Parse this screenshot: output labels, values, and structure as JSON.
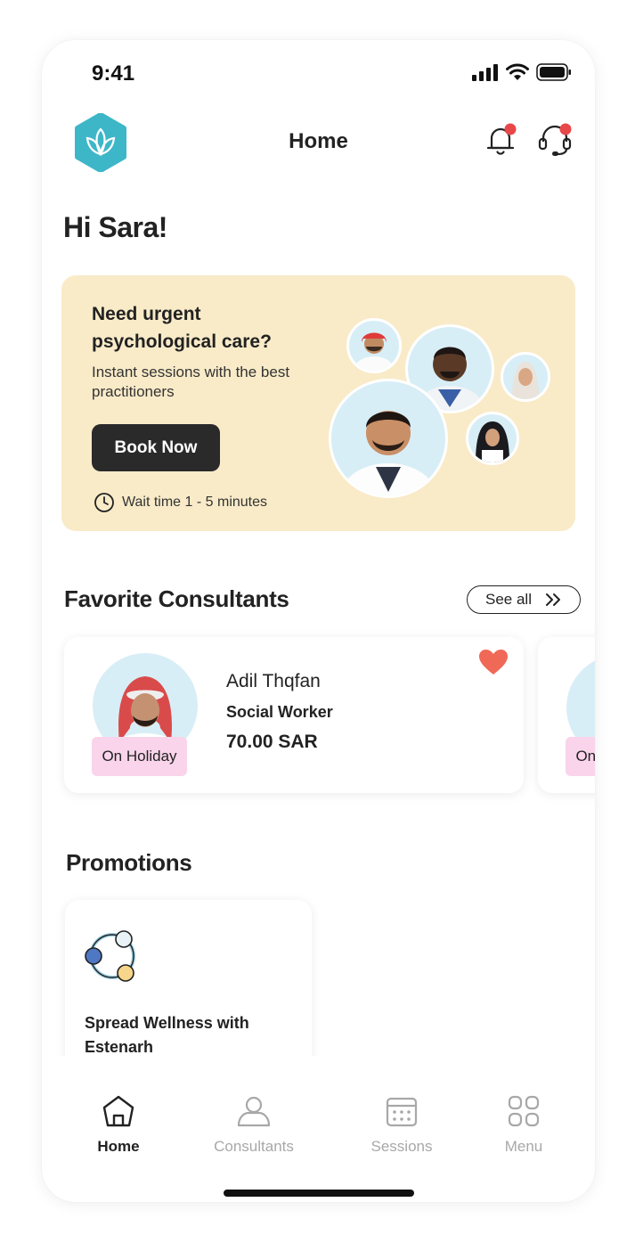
{
  "status_bar": {
    "time": "9:41"
  },
  "header": {
    "title": "Home"
  },
  "greeting": "Hi Sara!",
  "urgent_card": {
    "title": "Need urgent psychological care?",
    "subtitle": "Instant sessions with the best practitioners",
    "button_label": "Book Now",
    "wait_text": "Wait time 1 - 5 minutes"
  },
  "favorites": {
    "title": "Favorite Consultants",
    "see_all_label": "See all",
    "items": [
      {
        "name": "Adil Thqfan",
        "role": "Social Worker",
        "price": "70.00 SAR",
        "status": "On Holiday",
        "favorite": true
      },
      {
        "status": "On Holiday"
      }
    ]
  },
  "promotions": {
    "title": "Promotions",
    "items": [
      {
        "title": "Spread Wellness with Estenarh"
      }
    ]
  },
  "bottom_nav": {
    "items": [
      {
        "label": "Home",
        "icon": "home-icon",
        "active": true
      },
      {
        "label": "Consultants",
        "icon": "person-icon",
        "active": false
      },
      {
        "label": "Sessions",
        "icon": "calendar-icon",
        "active": false
      },
      {
        "label": "Menu",
        "icon": "grid-icon",
        "active": false
      }
    ]
  },
  "colors": {
    "accent": "#3db6c8",
    "card_yellow": "#f9ebc8",
    "badge_pink": "#f9d4ea",
    "heart": "#f06856",
    "notification_dot": "#e8474a"
  }
}
